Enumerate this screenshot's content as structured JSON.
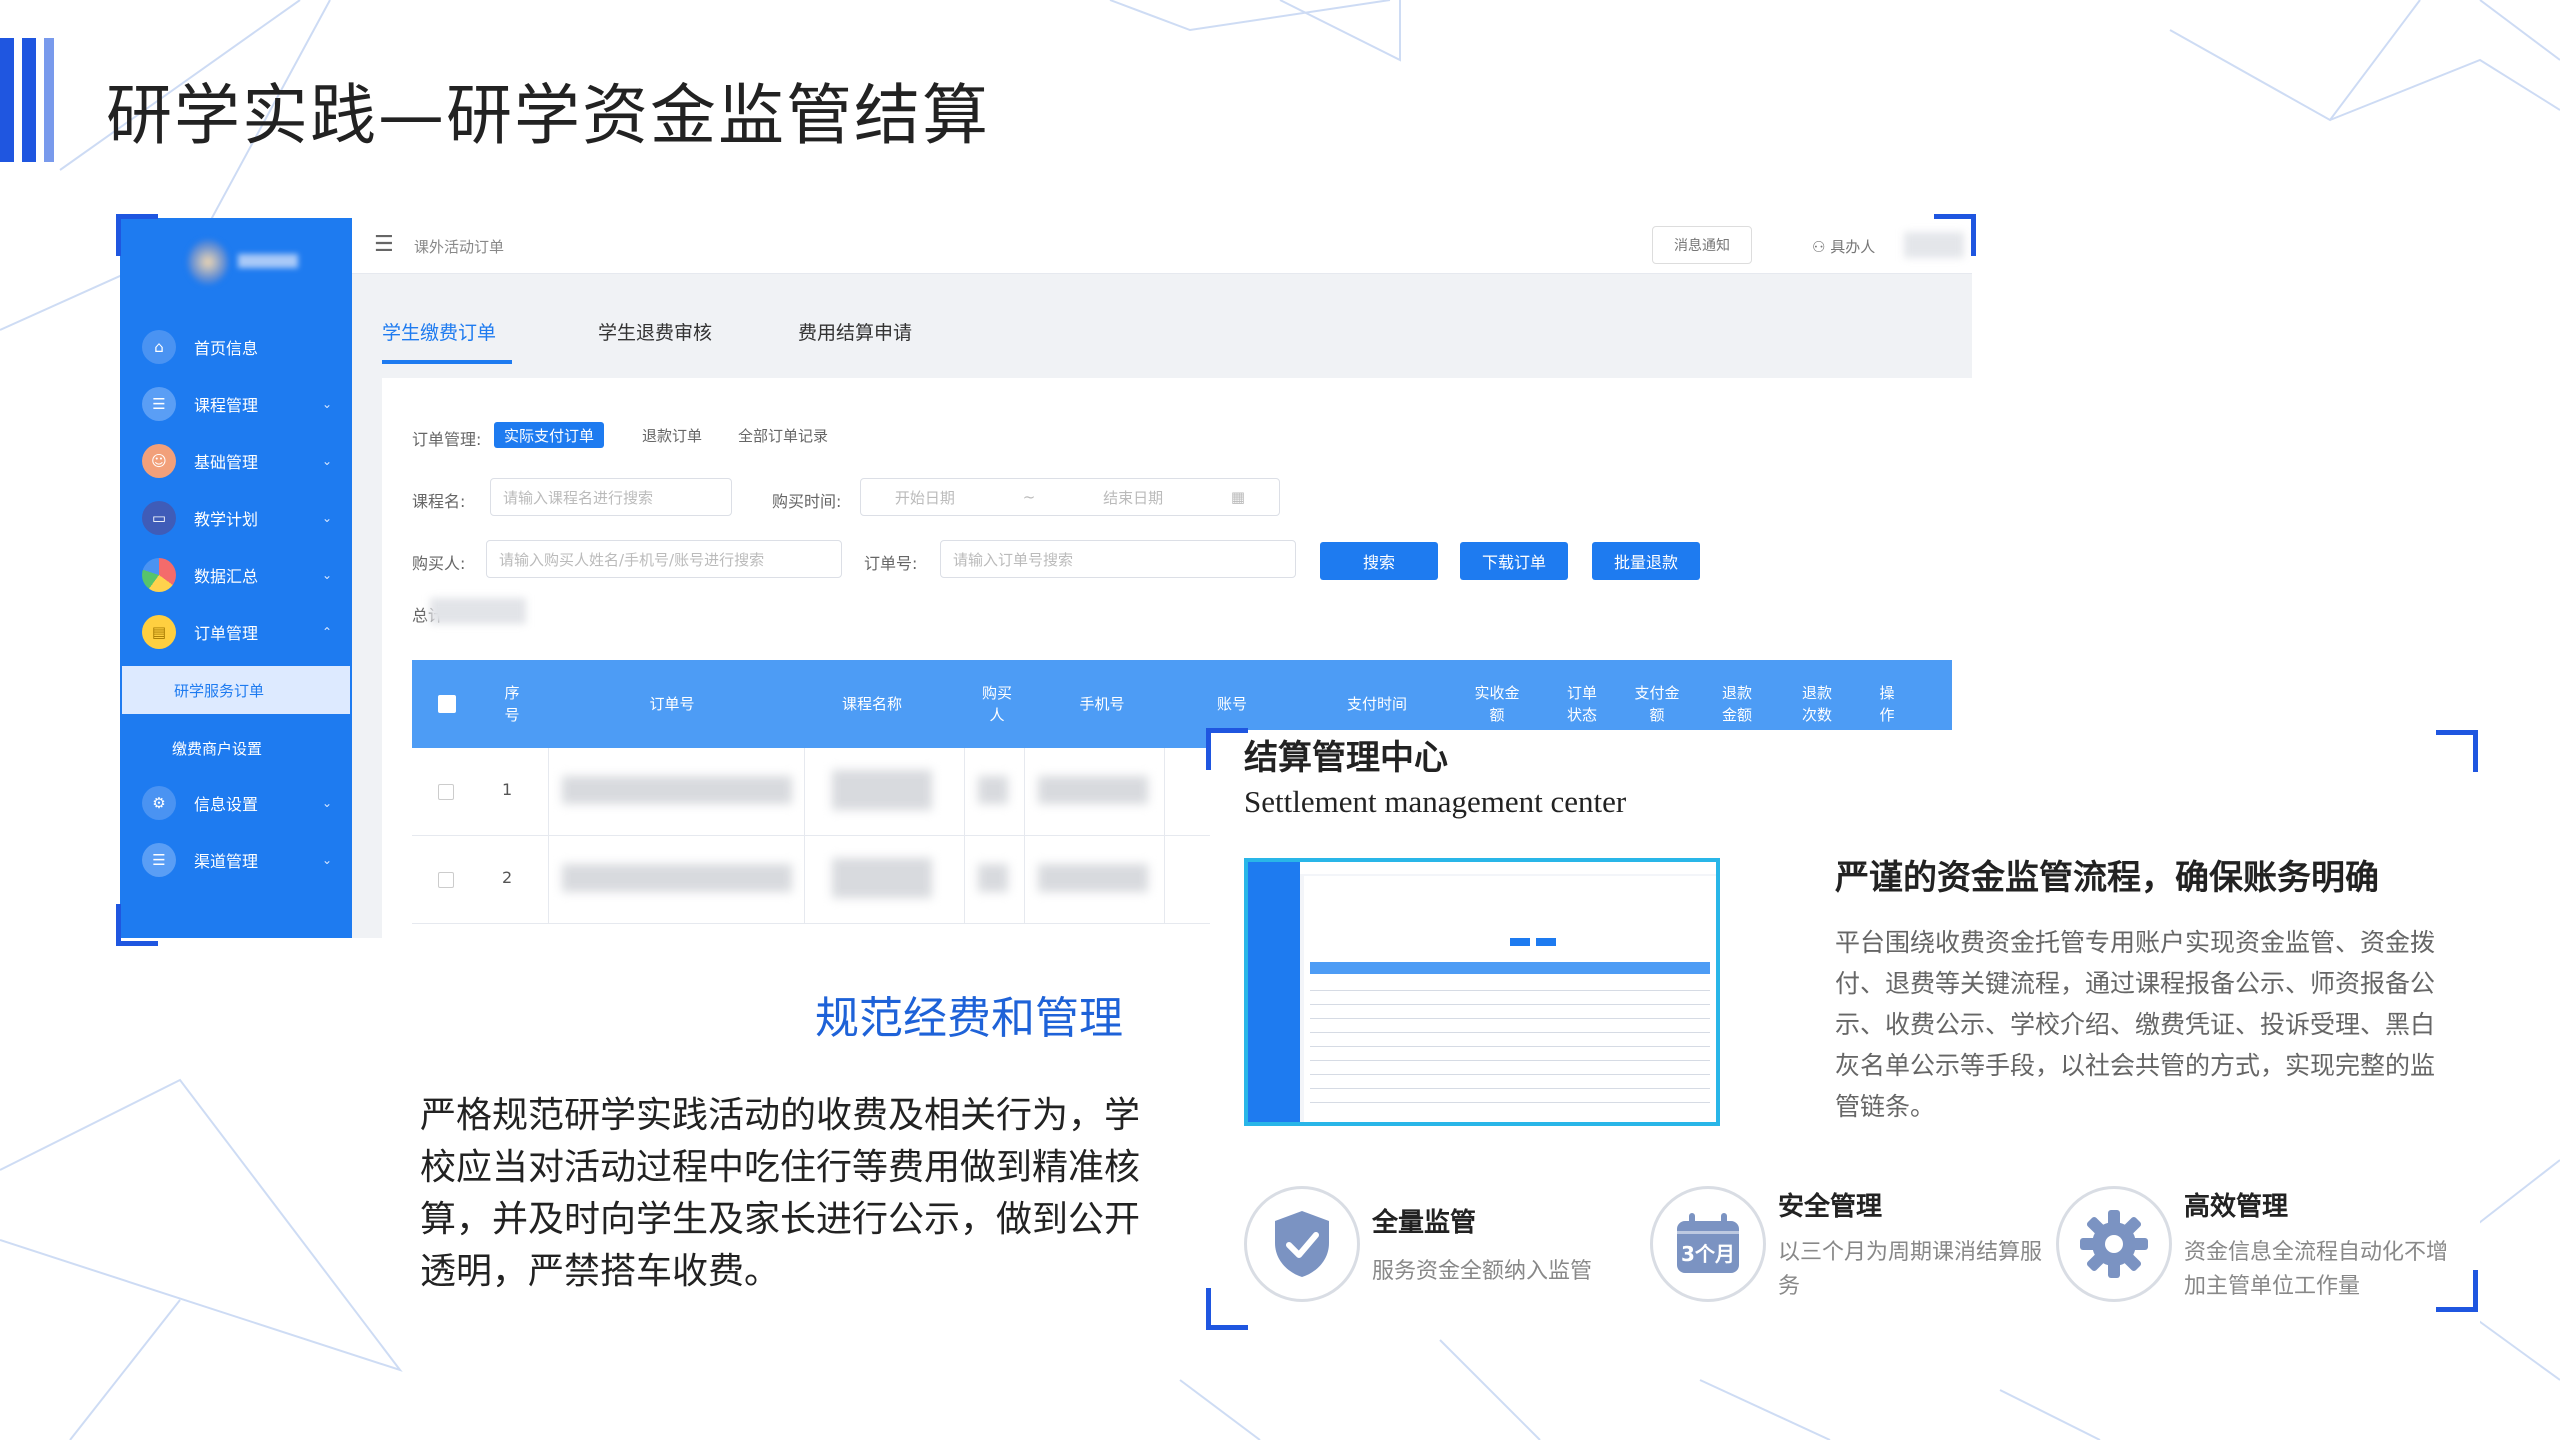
{
  "page": {
    "title": "研学实践—研学资金监管结算",
    "accent": "#1f56e0"
  },
  "app": {
    "breadcrumb": "课外活动订单",
    "notice_label": "消息通知",
    "user_label": "具办人",
    "sidebar": {
      "items": [
        {
          "label": "首页信息",
          "icon": "home-icon",
          "chevron": ""
        },
        {
          "label": "课程管理",
          "icon": "course-icon",
          "chevron": "⌄"
        },
        {
          "label": "基础管理",
          "icon": "base-icon",
          "chevron": "⌄"
        },
        {
          "label": "教学计划",
          "icon": "monitor-icon",
          "chevron": "⌄"
        },
        {
          "label": "数据汇总",
          "icon": "pie-icon",
          "chevron": "⌄"
        },
        {
          "label": "订单管理",
          "icon": "clipboard-icon",
          "chevron": "⌃"
        }
      ],
      "sub_items": [
        {
          "label": "研学服务订单",
          "active": true
        },
        {
          "label": "缴费商户设置",
          "active": false
        }
      ],
      "items_after": [
        {
          "label": "信息设置",
          "icon": "gear-icon",
          "chevron": "⌄"
        },
        {
          "label": "渠道管理",
          "icon": "channel-icon",
          "chevron": "⌄"
        }
      ]
    },
    "tabs": [
      {
        "label": "学生缴费订单",
        "active": true
      },
      {
        "label": "学生退费审核",
        "active": false
      },
      {
        "label": "费用结算申请",
        "active": false
      }
    ],
    "filters": {
      "order_mgmt_label": "订单管理:",
      "order_type_pills": [
        {
          "label": "实际支付订单",
          "active": true
        },
        {
          "label": "退款订单",
          "active": false
        },
        {
          "label": "全部订单记录",
          "active": false
        }
      ],
      "course_label": "课程名:",
      "course_placeholder": "请输入课程名进行搜索",
      "time_label": "购买时间:",
      "start_placeholder": "开始日期",
      "range_sep": "~",
      "end_placeholder": "结束日期",
      "buyer_label": "购买人:",
      "buyer_placeholder": "请输入购买人姓名/手机号/账号进行搜索",
      "order_no_label": "订单号:",
      "order_no_placeholder": "请输入订单号搜索",
      "search_btn": "搜索",
      "download_btn": "下载订单",
      "batch_refund_btn": "批量退款",
      "total_label": "总计"
    },
    "table": {
      "columns": [
        "序\n号",
        "订单号",
        "课程名称",
        "购买\n人",
        "手机号",
        "账号",
        "支付时间",
        "实收金\n额",
        "订单\n状态",
        "支付金\n额",
        "退款\n金额",
        "退款\n次数",
        "操\n作"
      ],
      "rows": [
        {
          "index": "1"
        },
        {
          "index": "2"
        }
      ]
    }
  },
  "settlement": {
    "title": "结算管理中心",
    "subtitle": "Settlement management center",
    "heading": "严谨的资金监管流程，确保账务明确",
    "paragraph": "平台围绕收费资金托管专用账户实现资金监管、资金拨付、退费等关键流程，通过课程报备公示、师资报备公示、收费公示、学校介绍、缴费凭证、投诉受理、黑白灰名单公示等手段，以社会共管的方式，实现完整的监管链条。",
    "features": [
      {
        "title": "全量监管",
        "desc": "服务资金全额纳入监管",
        "icon": "shield-check-icon"
      },
      {
        "title": "安全管理",
        "desc": "以三个月为周期课消结算服务",
        "icon": "calendar-icon",
        "badge": "3个月"
      },
      {
        "title": "高效管理",
        "desc": "资金信息全流程自动化不增加主管单位工作量",
        "icon": "gear-icon"
      }
    ]
  },
  "left_text": {
    "subhead": "规范经费和管理",
    "paragraph": "严格规范研学实践活动的收费及相关行为，学校应当对活动过程中吃住行等费用做到精准核算，并及时向学生及家长进行公示，做到公开透明，严禁搭车收费。"
  }
}
